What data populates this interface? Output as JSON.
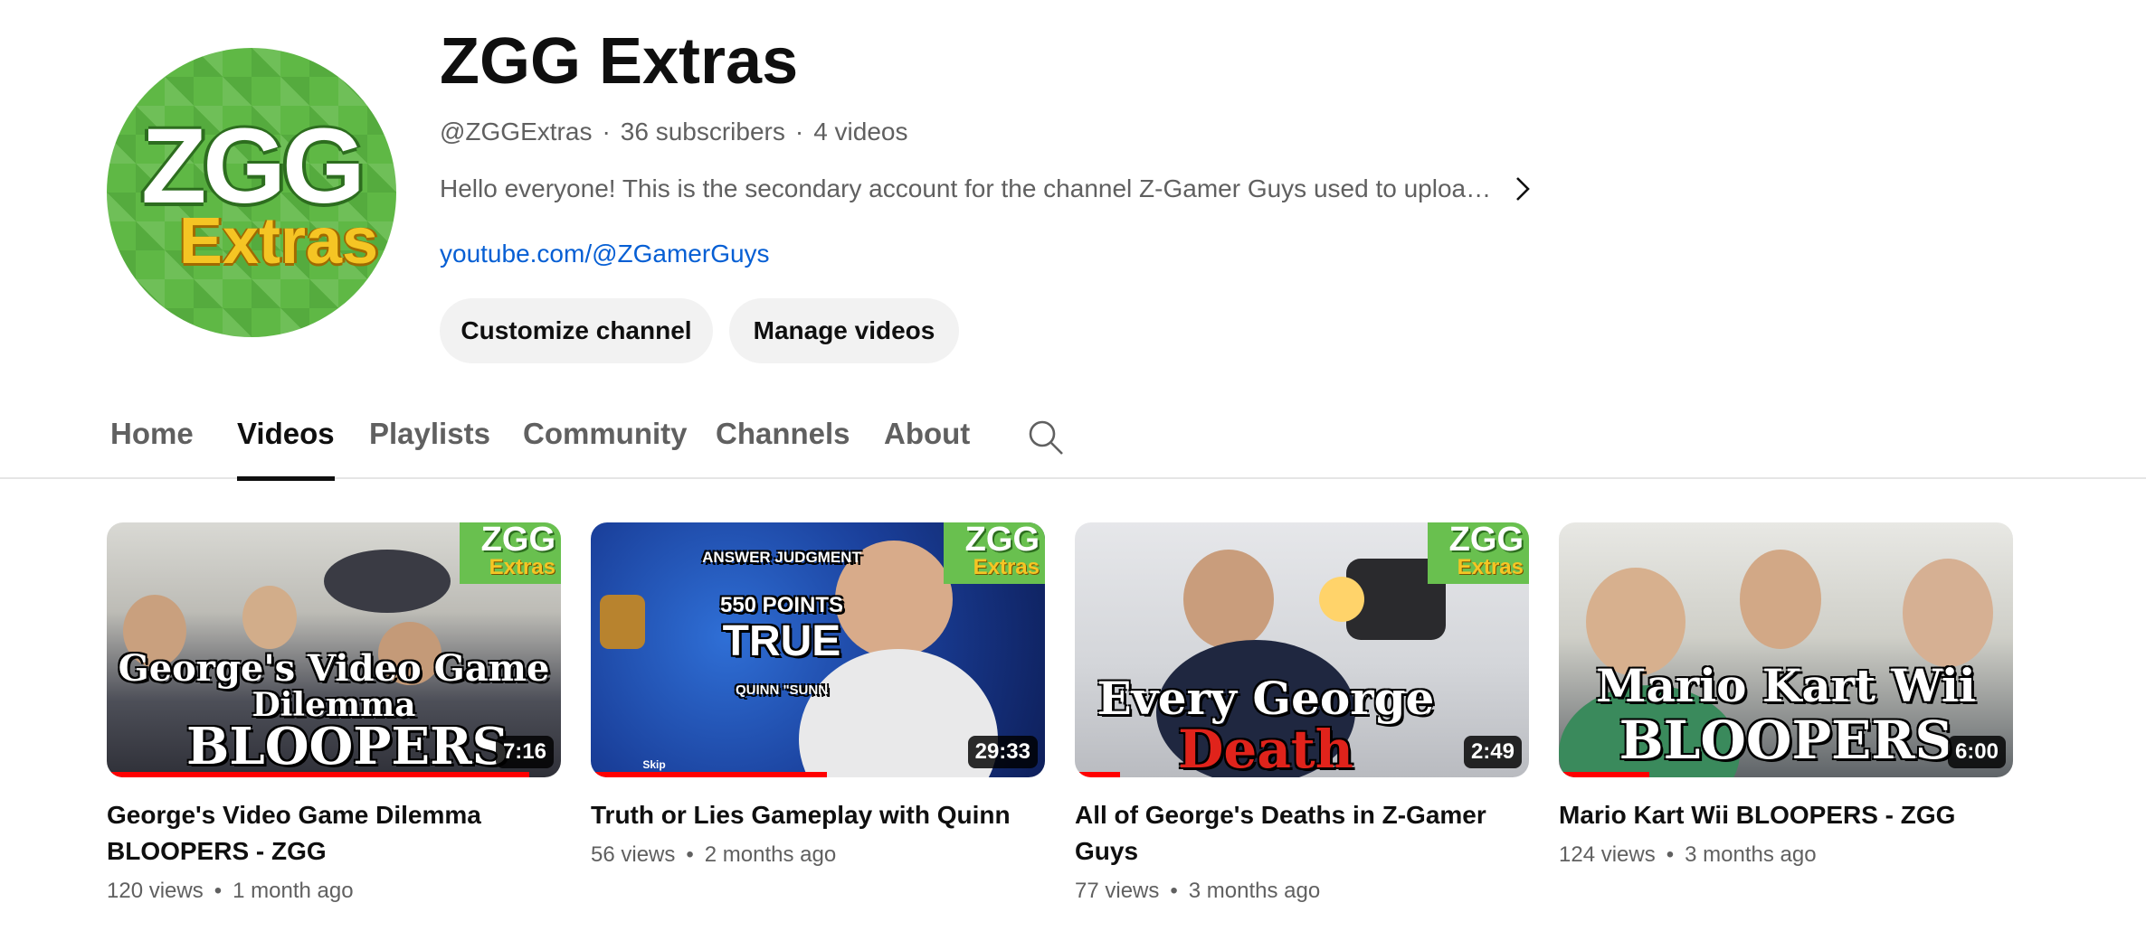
{
  "channel": {
    "name": "ZGG Extras",
    "avatar_text_top": "ZGG",
    "avatar_text_bottom": "Extras",
    "handle": "@ZGGExtras",
    "subscribers": "36 subscribers",
    "video_count": "4 videos",
    "description": "Hello everyone! This is the secondary account for the channel Z-Gamer Guys used to uploa…",
    "link": "youtube.com/@ZGamerGuys",
    "description_expand_icon": "chevron-right-icon"
  },
  "buttons": {
    "customize": "Customize channel",
    "manage": "Manage videos"
  },
  "tabs": [
    {
      "label": "Home",
      "active": false
    },
    {
      "label": "Videos",
      "active": true
    },
    {
      "label": "Playlists",
      "active": false
    },
    {
      "label": "Community",
      "active": false
    },
    {
      "label": "Channels",
      "active": false
    },
    {
      "label": "About",
      "active": false
    }
  ],
  "search_icon": "search-icon",
  "colors": {
    "accent_red": "#ff0000",
    "link_blue": "#065fd4",
    "brand_green": "#5fb845",
    "brand_yellow": "#f5c524"
  },
  "badge": {
    "top": "ZGG",
    "bottom": "Extras"
  },
  "videos": [
    {
      "title": "George's Video Game Dilemma BLOOPERS - ZGG",
      "views": "120 views",
      "age": "1 month ago",
      "duration": "7:16",
      "thumb_text_1": "George's Video Game",
      "thumb_text_2": "Dilemma",
      "thumb_text_3": "BLOOPERS",
      "watched_fraction": 0.93
    },
    {
      "title": "Truth or Lies Gameplay with Quinn",
      "views": "56 views",
      "age": "2 months ago",
      "duration": "29:33",
      "thumb_text_1": "ANSWER JUDGMENT",
      "thumb_text_2": "550 POINTS",
      "thumb_text_3": "TRUE",
      "thumb_text_4": "QUINN \"SUNN",
      "thumb_text_5": "Skip",
      "watched_fraction": 0.52
    },
    {
      "title": "All of George's Deaths in Z-Gamer Guys",
      "views": "77 views",
      "age": "3 months ago",
      "duration": "2:49",
      "thumb_text_1": "Every George",
      "thumb_text_2": "Death",
      "watched_fraction": 0.1
    },
    {
      "title": "Mario Kart Wii BLOOPERS - ZGG",
      "views": "124 views",
      "age": "3 months ago",
      "duration": "6:00",
      "thumb_text_1": "Mario Kart Wii",
      "thumb_text_2": "BLOOPERS",
      "watched_fraction": 0.2
    }
  ]
}
